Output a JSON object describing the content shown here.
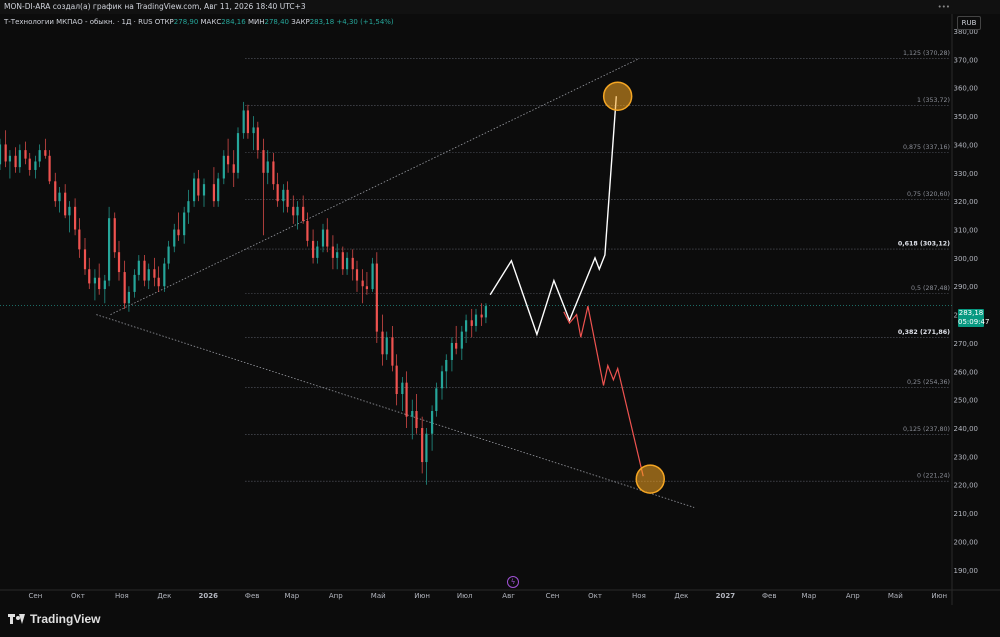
{
  "header": {
    "title": "MON-DI-ARA создал(а) график на TradingView.com, Авг 11, 2026 18:40 UTC+3"
  },
  "legend": {
    "symbol": "Т-Технологии МКПАО - обыкн. · 1Д · RUS",
    "open_label": "ОТКР",
    "open_value": "278,90",
    "high_label": "МАКС",
    "high_value": "284,16",
    "low_label": "МИН",
    "low_value": "278,40",
    "close_label": "ЗАКР",
    "close_value": "283,18",
    "change": "+4,30 (+1,54%)"
  },
  "currency": "RUB",
  "price_tag": {
    "price": "283,18",
    "countdown": "05:09:47"
  },
  "branding": {
    "logo_text": "TradingView"
  },
  "colors": {
    "up": "#26a69a",
    "down": "#ef5350",
    "bg": "#0c0c0c",
    "marker": "#f5a623",
    "bull_path": "#ffffff",
    "bear_path": "#ef5350"
  },
  "chart_data": {
    "type": "candlestick",
    "title": "",
    "xlabel": "",
    "ylabel": "",
    "ylim": [
      185,
      386
    ],
    "y_ticks": [
      190,
      200,
      210,
      220,
      230,
      240,
      250,
      260,
      270,
      280,
      290,
      300,
      310,
      320,
      330,
      340,
      350,
      360,
      370,
      380
    ],
    "y_tick_labels": [
      "190,00",
      "200,00",
      "210,00",
      "220,00",
      "230,00",
      "240,00",
      "250,00",
      "260,00",
      "270,00",
      "280,00",
      "290,00",
      "300,00",
      "310,00",
      "320,00",
      "330,00",
      "340,00",
      "350,00",
      "360,00",
      "370,00",
      "380,00"
    ],
    "x_ticks": [
      {
        "label": "Сен",
        "date": "2025-09-01"
      },
      {
        "label": "Окт",
        "date": "2025-10-01"
      },
      {
        "label": "Ноя",
        "date": "2025-11-01"
      },
      {
        "label": "Дек",
        "date": "2025-12-01"
      },
      {
        "label": "2026",
        "date": "2026-01-01"
      },
      {
        "label": "Фев",
        "date": "2026-02-01"
      },
      {
        "label": "Мар",
        "date": "2026-03-01"
      },
      {
        "label": "Апр",
        "date": "2026-04-01"
      },
      {
        "label": "Май",
        "date": "2026-05-01"
      },
      {
        "label": "Июн",
        "date": "2026-06-01"
      },
      {
        "label": "Июл",
        "date": "2026-07-01"
      },
      {
        "label": "Авг",
        "date": "2026-08-01"
      },
      {
        "label": "Сен",
        "date": "2026-09-01"
      },
      {
        "label": "Окт",
        "date": "2026-10-01"
      },
      {
        "label": "Ноя",
        "date": "2026-11-01"
      },
      {
        "label": "Дек",
        "date": "2026-12-01"
      },
      {
        "label": "2027",
        "date": "2027-01-01"
      },
      {
        "label": "Фев",
        "date": "2027-02-01"
      },
      {
        "label": "Мар",
        "date": "2027-03-01"
      },
      {
        "label": "Апр",
        "date": "2027-04-01"
      },
      {
        "label": "Май",
        "date": "2027-05-01"
      },
      {
        "label": "Июн",
        "date": "2027-06-01"
      }
    ],
    "x_range": [
      "2025-08-07",
      "2027-06-10"
    ],
    "fib_levels": [
      {
        "ratio": "0",
        "price": 221.24,
        "label": "0 (221,24)",
        "bold": false
      },
      {
        "ratio": "0.125",
        "price": 237.8,
        "label": "0,125 (237,80)",
        "bold": false
      },
      {
        "ratio": "0.25",
        "price": 254.36,
        "label": "0,25 (254,36)",
        "bold": false
      },
      {
        "ratio": "0.382",
        "price": 271.86,
        "label": "0,382 (271,86)",
        "bold": true
      },
      {
        "ratio": "0.5",
        "price": 287.48,
        "label": "0,5 (287,48)",
        "bold": false
      },
      {
        "ratio": "0.618",
        "price": 303.12,
        "label": "0,618 (303,12)",
        "bold": true
      },
      {
        "ratio": "0.75",
        "price": 320.6,
        "label": "0,75 (320,60)",
        "bold": false
      },
      {
        "ratio": "0.875",
        "price": 337.16,
        "label": "0,875 (337,16)",
        "bold": false
      },
      {
        "ratio": "1",
        "price": 353.72,
        "label": "1 (353,72)",
        "bold": false
      },
      {
        "ratio": "1.125",
        "price": 370.28,
        "label": "1,125 (370,28)",
        "bold": false
      }
    ],
    "fib_start_date": "2026-01-27",
    "last_price": 283.18,
    "trendlines": [
      {
        "name": "upper",
        "points": [
          [
            "2025-10-24",
            280
          ],
          [
            "2026-10-31",
            370
          ]
        ]
      },
      {
        "name": "lower",
        "points": [
          [
            "2025-10-14",
            280
          ],
          [
            "2026-12-10",
            212
          ]
        ]
      }
    ],
    "candles": [
      [
        "2025-08-07",
        333,
        342,
        331,
        340
      ],
      [
        "2025-08-11",
        340,
        345,
        332,
        334
      ],
      [
        "2025-08-14",
        334,
        338,
        328,
        336
      ],
      [
        "2025-08-18",
        336,
        339,
        330,
        332
      ],
      [
        "2025-08-21",
        332,
        340,
        330,
        338
      ],
      [
        "2025-08-25",
        338,
        341,
        333,
        335
      ],
      [
        "2025-08-28",
        335,
        337,
        329,
        331
      ],
      [
        "2025-09-01",
        331,
        336,
        328,
        334
      ],
      [
        "2025-09-04",
        334,
        340,
        332,
        338
      ],
      [
        "2025-09-08",
        338,
        342,
        335,
        336
      ],
      [
        "2025-09-11",
        336,
        338,
        326,
        327
      ],
      [
        "2025-09-15",
        327,
        330,
        318,
        320
      ],
      [
        "2025-09-18",
        320,
        325,
        316,
        323
      ],
      [
        "2025-09-22",
        323,
        326,
        314,
        315
      ],
      [
        "2025-09-25",
        315,
        320,
        309,
        318
      ],
      [
        "2025-09-29",
        318,
        321,
        308,
        310
      ],
      [
        "2025-10-02",
        310,
        314,
        300,
        303
      ],
      [
        "2025-10-06",
        303,
        307,
        294,
        296
      ],
      [
        "2025-10-09",
        296,
        300,
        289,
        291
      ],
      [
        "2025-10-13",
        291,
        296,
        285,
        293
      ],
      [
        "2025-10-16",
        293,
        298,
        287,
        289
      ],
      [
        "2025-10-20",
        289,
        294,
        284,
        292
      ],
      [
        "2025-10-23",
        292,
        318,
        290,
        314
      ],
      [
        "2025-10-27",
        314,
        316,
        300,
        302
      ],
      [
        "2025-10-30",
        302,
        306,
        292,
        295
      ],
      [
        "2025-11-03",
        295,
        299,
        282,
        284
      ],
      [
        "2025-11-06",
        284,
        290,
        281,
        288
      ],
      [
        "2025-11-10",
        288,
        296,
        286,
        294
      ],
      [
        "2025-11-13",
        294,
        301,
        292,
        299
      ],
      [
        "2025-11-17",
        299,
        301,
        290,
        292
      ],
      [
        "2025-11-20",
        292,
        298,
        289,
        296
      ],
      [
        "2025-11-24",
        296,
        300,
        290,
        293
      ],
      [
        "2025-11-27",
        293,
        297,
        288,
        290
      ],
      [
        "2025-12-01",
        290,
        300,
        288,
        298
      ],
      [
        "2025-12-04",
        298,
        306,
        296,
        304
      ],
      [
        "2025-12-08",
        304,
        312,
        302,
        310
      ],
      [
        "2025-12-11",
        310,
        316,
        306,
        308
      ],
      [
        "2025-12-15",
        308,
        318,
        305,
        316
      ],
      [
        "2025-12-18",
        316,
        324,
        312,
        320
      ],
      [
        "2025-12-22",
        320,
        330,
        318,
        328
      ],
      [
        "2025-12-25",
        328,
        331,
        320,
        322
      ],
      [
        "2025-12-29",
        322,
        328,
        318,
        326
      ],
      [
        "2026-01-05",
        326,
        332,
        318,
        320
      ],
      [
        "2026-01-08",
        320,
        330,
        318,
        328
      ],
      [
        "2026-01-12",
        328,
        338,
        326,
        336
      ],
      [
        "2026-01-15",
        336,
        342,
        330,
        333
      ],
      [
        "2026-01-19",
        333,
        338,
        325,
        330
      ],
      [
        "2026-01-22",
        330,
        346,
        328,
        344
      ],
      [
        "2026-01-26",
        344,
        355,
        342,
        352
      ],
      [
        "2026-01-29",
        352,
        354,
        342,
        344
      ],
      [
        "2026-02-02",
        344,
        350,
        338,
        346
      ],
      [
        "2026-02-05",
        346,
        348,
        335,
        338
      ],
      [
        "2026-02-09",
        338,
        342,
        308,
        330
      ],
      [
        "2026-02-12",
        330,
        338,
        326,
        334
      ],
      [
        "2026-02-16",
        334,
        337,
        324,
        326
      ],
      [
        "2026-02-19",
        326,
        330,
        318,
        320
      ],
      [
        "2026-02-23",
        320,
        326,
        316,
        324
      ],
      [
        "2026-02-26",
        324,
        327,
        316,
        318
      ],
      [
        "2026-03-02",
        318,
        322,
        312,
        315
      ],
      [
        "2026-03-05",
        315,
        320,
        310,
        318
      ],
      [
        "2026-03-09",
        318,
        322,
        312,
        313
      ],
      [
        "2026-03-12",
        313,
        316,
        304,
        306
      ],
      [
        "2026-03-16",
        306,
        310,
        298,
        300
      ],
      [
        "2026-03-19",
        300,
        306,
        298,
        304
      ],
      [
        "2026-03-23",
        304,
        312,
        302,
        310
      ],
      [
        "2026-03-26",
        310,
        314,
        302,
        304
      ],
      [
        "2026-03-30",
        304,
        308,
        296,
        300
      ],
      [
        "2026-04-02",
        300,
        305,
        296,
        302
      ],
      [
        "2026-04-06",
        302,
        304,
        294,
        296
      ],
      [
        "2026-04-09",
        296,
        302,
        294,
        300
      ],
      [
        "2026-04-13",
        300,
        303,
        292,
        296
      ],
      [
        "2026-04-16",
        296,
        299,
        288,
        292
      ],
      [
        "2026-04-20",
        292,
        296,
        284,
        290
      ],
      [
        "2026-04-23",
        290,
        295,
        287,
        289
      ],
      [
        "2026-04-27",
        289,
        300,
        288,
        298
      ],
      [
        "2026-04-30",
        298,
        302,
        270,
        274
      ],
      [
        "2026-05-04",
        274,
        280,
        262,
        266
      ],
      [
        "2026-05-07",
        266,
        274,
        264,
        272
      ],
      [
        "2026-05-11",
        272,
        276,
        260,
        262
      ],
      [
        "2026-05-14",
        262,
        266,
        248,
        252
      ],
      [
        "2026-05-18",
        252,
        258,
        246,
        256
      ],
      [
        "2026-05-21",
        256,
        260,
        240,
        244
      ],
      [
        "2026-05-25",
        244,
        250,
        236,
        246
      ],
      [
        "2026-05-28",
        246,
        252,
        238,
        240
      ],
      [
        "2026-06-01",
        240,
        244,
        224,
        228
      ],
      [
        "2026-06-04",
        228,
        240,
        220,
        238
      ],
      [
        "2026-06-08",
        238,
        248,
        232,
        246
      ],
      [
        "2026-06-11",
        246,
        256,
        244,
        254
      ],
      [
        "2026-06-15",
        254,
        262,
        250,
        260
      ],
      [
        "2026-06-18",
        260,
        266,
        254,
        264
      ],
      [
        "2026-06-22",
        264,
        272,
        260,
        270
      ],
      [
        "2026-06-25",
        270,
        276,
        266,
        268
      ],
      [
        "2026-06-29",
        268,
        276,
        264,
        274
      ],
      [
        "2026-07-02",
        274,
        280,
        270,
        278
      ],
      [
        "2026-07-06",
        278,
        282,
        272,
        276
      ],
      [
        "2026-07-09",
        276,
        282,
        274,
        280
      ],
      [
        "2026-07-13",
        280,
        284,
        276,
        279
      ],
      [
        "2026-07-16",
        279,
        284,
        277,
        283
      ]
    ],
    "projection_bull": [
      [
        "2026-07-19",
        287
      ],
      [
        "2026-08-03",
        299
      ],
      [
        "2026-08-21",
        273
      ],
      [
        "2026-09-02",
        292
      ],
      [
        "2026-09-13",
        278
      ],
      [
        "2026-10-01",
        300
      ],
      [
        "2026-10-04",
        296
      ],
      [
        "2026-10-08",
        301
      ],
      [
        "2026-10-16",
        357
      ]
    ],
    "projection_bear": [
      [
        "2026-09-09",
        281
      ],
      [
        "2026-09-13",
        277
      ],
      [
        "2026-09-18",
        280
      ],
      [
        "2026-09-21",
        272
      ],
      [
        "2026-09-26",
        283
      ],
      [
        "2026-10-07",
        255
      ],
      [
        "2026-10-10",
        262
      ],
      [
        "2026-10-14",
        257
      ],
      [
        "2026-10-17",
        261
      ],
      [
        "2026-11-04",
        223
      ]
    ],
    "markers": [
      {
        "name": "target-high",
        "date": "2026-10-17",
        "price": 357
      },
      {
        "name": "target-low",
        "date": "2026-11-09",
        "price": 222
      }
    ]
  }
}
